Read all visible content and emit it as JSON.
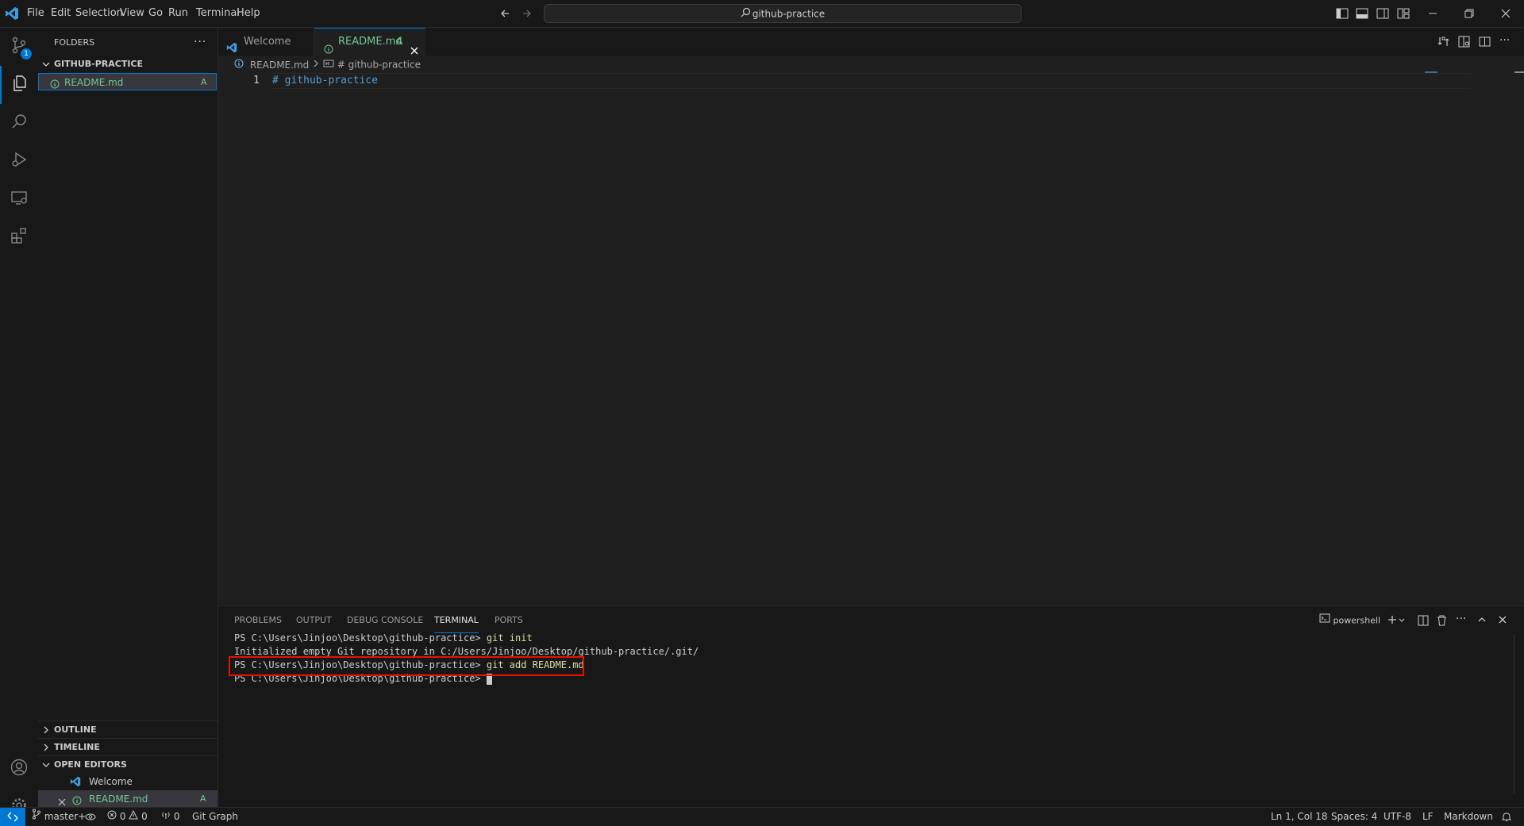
{
  "titlebar": {
    "menu": [
      "File",
      "Edit",
      "Selection",
      "View",
      "Go",
      "Run",
      "Terminal",
      "Help"
    ],
    "search_text": "github-practice"
  },
  "activity": {
    "scm_badge": "1"
  },
  "explorer": {
    "header": "FOLDERS",
    "folder": "GITHUB-PRACTICE",
    "files": [
      {
        "name": "README.md",
        "status": "A"
      }
    ],
    "outline": "OUTLINE",
    "timeline": "TIMELINE",
    "open_editors": "OPEN EDITORS",
    "open_items": [
      {
        "name": "Welcome",
        "status": ""
      },
      {
        "name": "README.md",
        "status": "A"
      }
    ]
  },
  "tabs": [
    {
      "label": "Welcome"
    },
    {
      "label": "README.md",
      "status": "A"
    }
  ],
  "breadcrumb": {
    "file": "README.md",
    "symbol": "# github-practice"
  },
  "editor": {
    "line_number": "1",
    "content": "# github-practice"
  },
  "panel": {
    "tabs": [
      "PROBLEMS",
      "OUTPUT",
      "DEBUG CONSOLE",
      "TERMINAL",
      "PORTS"
    ],
    "active_tab": "TERMINAL",
    "shell": "powershell",
    "lines": [
      {
        "prompt": "PS C:\\Users\\Jinjoo\\Desktop\\github-practice> ",
        "command": "git init"
      },
      {
        "prompt": "Initialized empty Git repository in C:/Users/Jinjoo/Desktop/github-practice/.git/",
        "command": ""
      },
      {
        "prompt": "PS C:\\Users\\Jinjoo\\Desktop\\github-practice> ",
        "command": "git add README.md"
      },
      {
        "prompt": "PS C:\\Users\\Jinjoo\\Desktop\\github-practice> ",
        "command": ""
      }
    ]
  },
  "statusbar": {
    "branch": "master+",
    "errors": "0",
    "warnings": "0",
    "ports": "0",
    "git_graph": "Git Graph",
    "position": "Ln 1, Col 18",
    "spaces": "Spaces: 4",
    "encoding": "UTF-8",
    "eol": "LF",
    "language": "Markdown"
  },
  "colors": {
    "accent": "#0078d4",
    "added_file": "#73c991",
    "highlight_box": "#e51400",
    "heading": "#569cd6",
    "command": "#dcdcaa"
  }
}
